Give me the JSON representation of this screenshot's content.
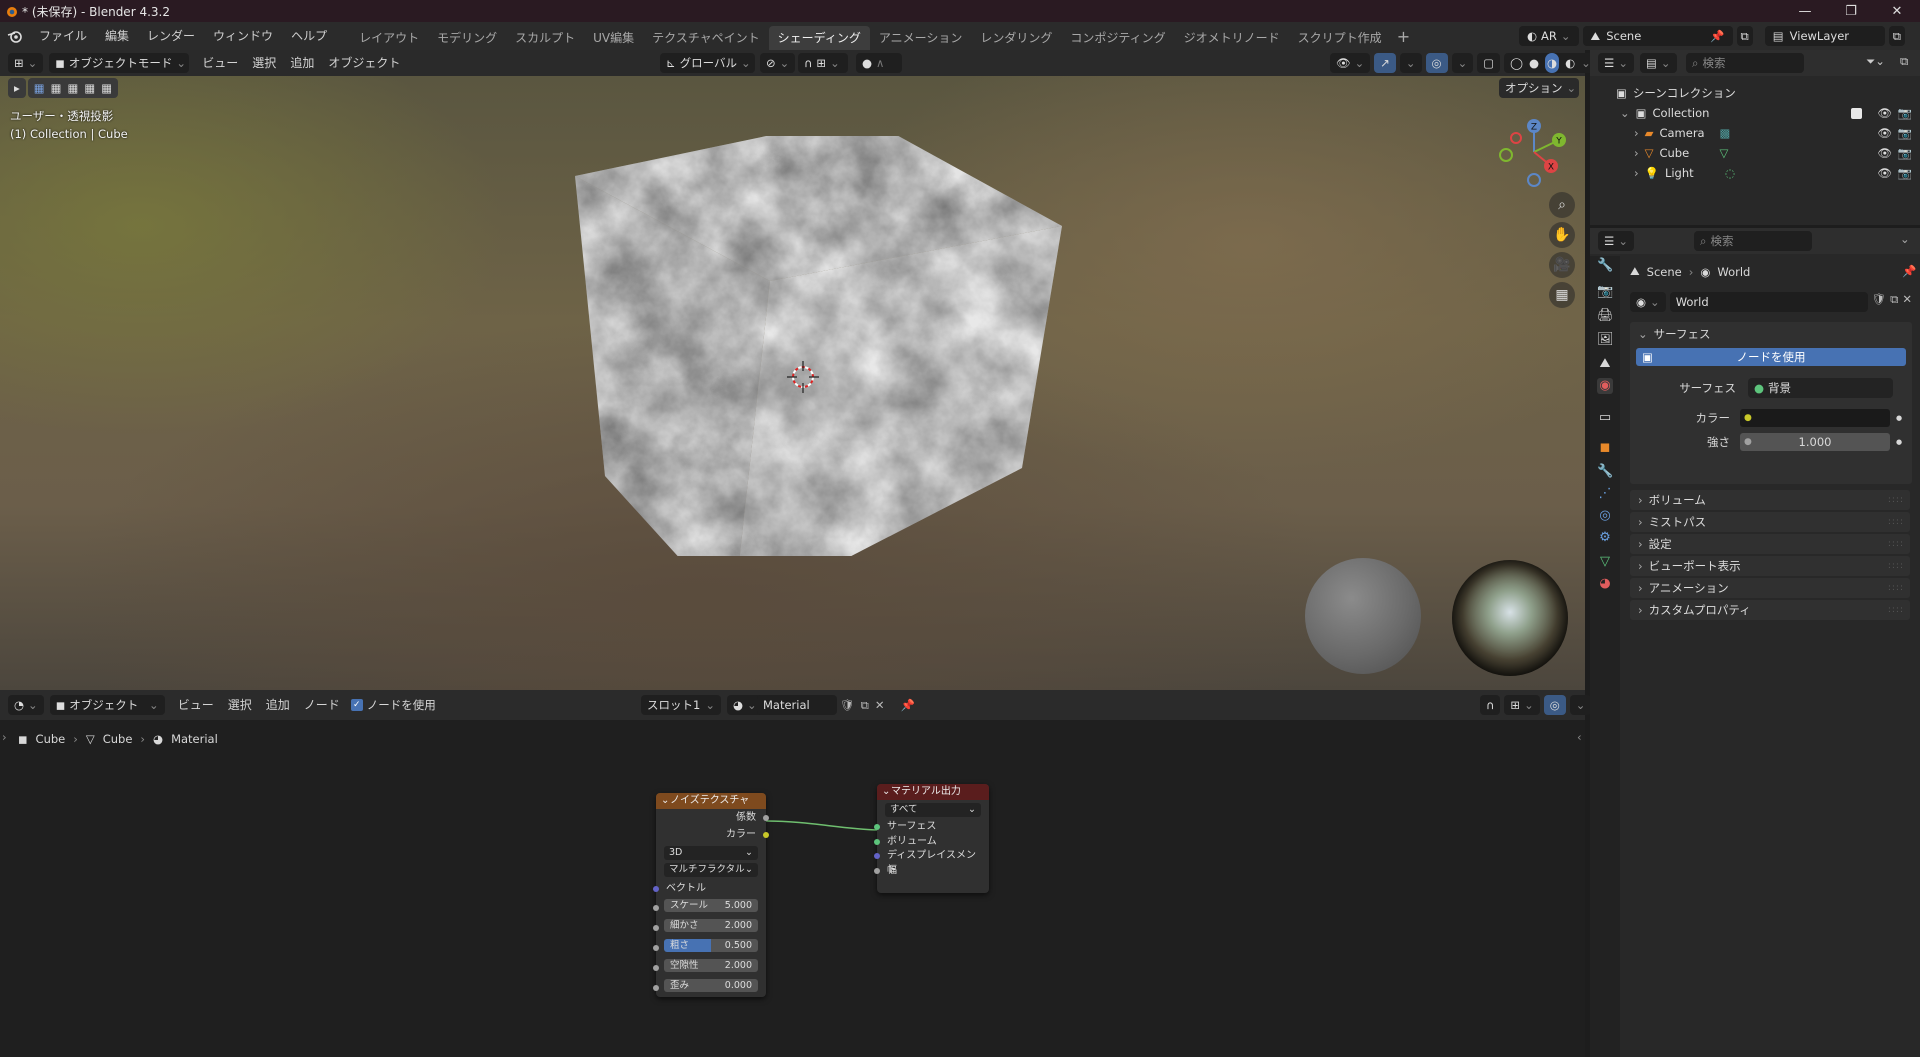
{
  "window": {
    "title": "* (未保存) - Blender 4.3.2"
  },
  "menu": [
    "ファイル",
    "編集",
    "レンダー",
    "ウィンドウ",
    "ヘルプ"
  ],
  "workspaces": [
    {
      "label": "レイアウト",
      "active": false
    },
    {
      "label": "モデリング",
      "active": false
    },
    {
      "label": "スカルプト",
      "active": false
    },
    {
      "label": "UV編集",
      "active": false
    },
    {
      "label": "テクスチャペイント",
      "active": false
    },
    {
      "label": "シェーディング",
      "active": true
    },
    {
      "label": "アニメーション",
      "active": false
    },
    {
      "label": "レンダリング",
      "active": false
    },
    {
      "label": "コンポジティング",
      "active": false
    },
    {
      "label": "ジオメトリノード",
      "active": false
    },
    {
      "label": "スクリプト作成",
      "active": false
    }
  ],
  "topright": {
    "ar": "AR",
    "scene": "Scene",
    "viewlayer": "ViewLayer"
  },
  "viewport_header": {
    "mode": "オブジェクトモード",
    "menus": [
      "ビュー",
      "選択",
      "追加",
      "オブジェクト"
    ],
    "transform": "グローバル",
    "options": "オプション"
  },
  "viewport": {
    "view_label": "ユーザー・透視投影",
    "collection_label": "(1) Collection | Cube",
    "gizmo": {
      "z": "Z",
      "y": "Y",
      "x": "X"
    }
  },
  "shader_header": {
    "type": "オブジェクト",
    "menus": [
      "ビュー",
      "選択",
      "追加",
      "ノード"
    ],
    "use_nodes": "ノードを使用",
    "slot": "スロット1",
    "material": "Material"
  },
  "breadcrumb": [
    "Cube",
    "Cube",
    "Material"
  ],
  "nodes": {
    "noise": {
      "title": "ノイズテクスチャ",
      "out_fac": "係数",
      "out_color": "カラー",
      "dim": "3D",
      "type": "マルチフラクタル",
      "vector": "ベクトル",
      "fields": [
        {
          "label": "スケール",
          "value": "5.000",
          "active": false
        },
        {
          "label": "細かさ",
          "value": "2.000",
          "active": false
        },
        {
          "label": "粗さ",
          "value": "0.500",
          "active": true
        },
        {
          "label": "空隙性",
          "value": "2.000",
          "active": false
        },
        {
          "label": "歪み",
          "value": "0.000",
          "active": false
        }
      ]
    },
    "output": {
      "title": "マテリアル出力",
      "target": "すべて",
      "inputs": [
        "サーフェス",
        "ボリューム",
        "ディスプレイスメント",
        "幅"
      ]
    }
  },
  "outliner": {
    "search": "検索",
    "root": "シーンコレクション",
    "collection": "Collection",
    "items": [
      "Camera",
      "Cube",
      "Light"
    ]
  },
  "properties": {
    "search": "検索",
    "breadcrumb_scene": "Scene",
    "breadcrumb_world": "World",
    "world_name": "World",
    "surface_panel": "サーフェス",
    "use_nodes": "ノードを使用",
    "surface_label": "サーフェス",
    "surface_value": "背景",
    "color_label": "カラー",
    "strength_label": "強さ",
    "strength_value": "1.000",
    "panels": [
      "ボリューム",
      "ミストパス",
      "設定",
      "ビューポート表示",
      "アニメーション",
      "カスタムプロパティ"
    ]
  },
  "colors": {
    "accent": "#4772b3",
    "noise_header": "#7e4a1e",
    "output_header": "#5a1d1d",
    "link": "#6fbf6f"
  }
}
